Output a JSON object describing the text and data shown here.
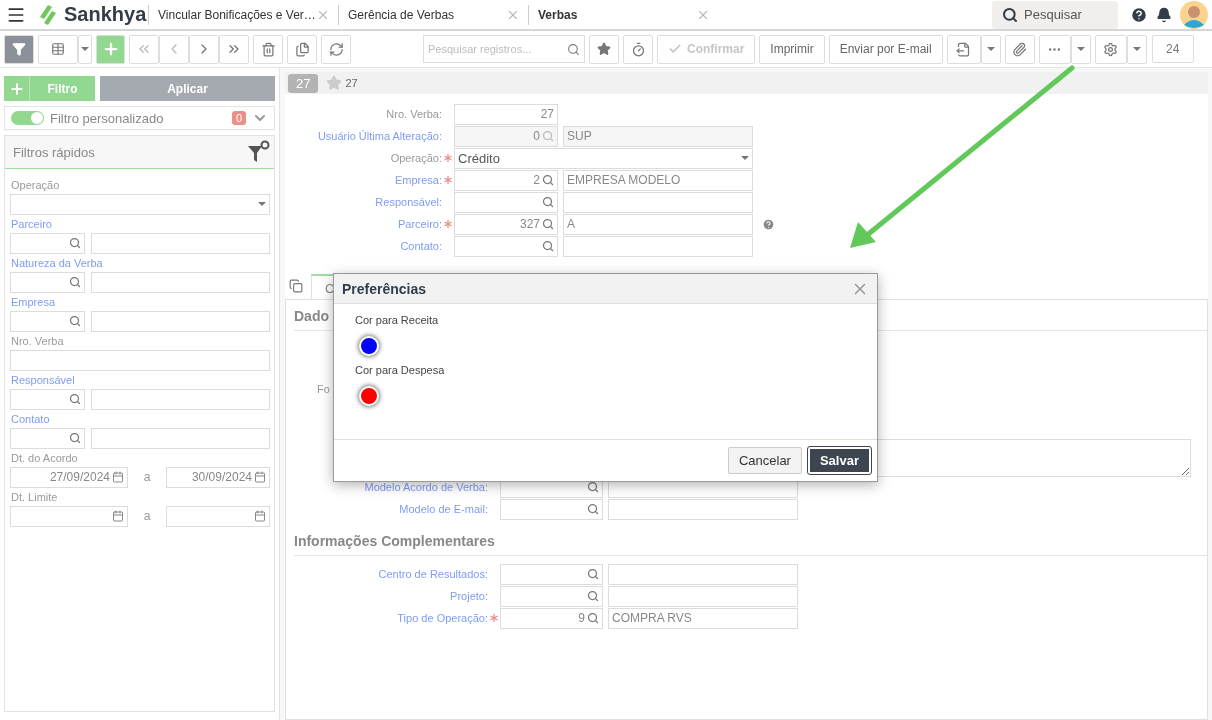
{
  "header": {
    "logo": "Sankhya",
    "tabs": [
      {
        "label": "Vincular Bonificações e Ver…",
        "selected": false
      },
      {
        "label": "Gerência de Verbas",
        "selected": false
      },
      {
        "label": "Verbas",
        "selected": true
      }
    ],
    "search": {
      "placeholder": "Pesquisar"
    }
  },
  "toolbar": {
    "search_placeholder": "Pesquisar registros...",
    "buttons": [
      {
        "label": "Confirmar",
        "disabled": true
      },
      {
        "label": "Imprimir",
        "disabled": false
      },
      {
        "label": "Enviar por E-mail",
        "disabled": false
      }
    ],
    "counter": "24"
  },
  "sidebar": {
    "filter_button": "Filtro",
    "apply_button": "Aplicar",
    "custom_filter": {
      "label": "Filtro personalizado",
      "on": true,
      "count": "0"
    },
    "quick_filters_title": "Filtros rápidos",
    "fields": [
      {
        "kind": "select",
        "label": "Operação"
      },
      {
        "kind": "lookup",
        "label": "Parceiro"
      },
      {
        "kind": "lookup",
        "label": "Natureza da Verba"
      },
      {
        "kind": "lookup",
        "label": "Empresa"
      },
      {
        "kind": "text",
        "label": "Nro. Verba"
      },
      {
        "kind": "lookup",
        "label": "Responsável"
      },
      {
        "kind": "lookup",
        "label": "Contato"
      },
      {
        "kind": "daterange",
        "label": "Dt. do Acordo",
        "from": "27/09/2024",
        "separator": "a",
        "to": "30/09/2024"
      },
      {
        "kind": "daterange",
        "label": "Dt. Limite",
        "separator": "a"
      }
    ]
  },
  "record": {
    "badge": "27",
    "favorite_count": "27"
  },
  "form": {
    "fields": [
      {
        "kind": "text",
        "label": "Nro. Verba:",
        "value": "27"
      },
      {
        "kind": "lookup",
        "label": "Usuário Última Alteração:",
        "code": "0",
        "description": "SUP",
        "disabled": true
      },
      {
        "kind": "select",
        "label": "Operação:",
        "required": true,
        "value": "Crédito"
      },
      {
        "kind": "lookup",
        "label": "Empresa:",
        "required": true,
        "code": "2",
        "description": "EMPRESA MODELO"
      },
      {
        "kind": "lookup",
        "label": "Responsável:"
      },
      {
        "kind": "lookup",
        "label": "Parceiro:",
        "required": true,
        "code": "327",
        "description": "A",
        "help": true
      },
      {
        "kind": "lookup",
        "label": "Contato:"
      }
    ]
  },
  "detail_tabs": [
    {
      "label": "C",
      "selected": true
    }
  ],
  "section_main": {
    "title": "Dado",
    "hidden_label": "Fo",
    "fields": [
      {
        "kind": "lookup",
        "label": "Modelo Acordo de Verba:"
      },
      {
        "kind": "lookup",
        "label": "Modelo de E-mail:"
      }
    ]
  },
  "section_extra": {
    "title": "Informações Complementares",
    "fields": [
      {
        "kind": "lookup",
        "label": "Centro de Resultados:"
      },
      {
        "kind": "lookup",
        "label": "Projeto:"
      },
      {
        "kind": "lookup",
        "label": "Tipo de Operação:",
        "required": true,
        "code": "9",
        "description": "COMPRA RVS"
      }
    ]
  },
  "dialog": {
    "title": "Preferências",
    "colors": [
      {
        "label": "Cor para Receita",
        "color": "#0000ff"
      },
      {
        "label": "Cor para Despesa",
        "color": "#ff0000"
      }
    ],
    "buttons": [
      {
        "label": "Cancelar",
        "kind": "secondary"
      },
      {
        "label": "Salvar",
        "kind": "primary"
      }
    ]
  }
}
